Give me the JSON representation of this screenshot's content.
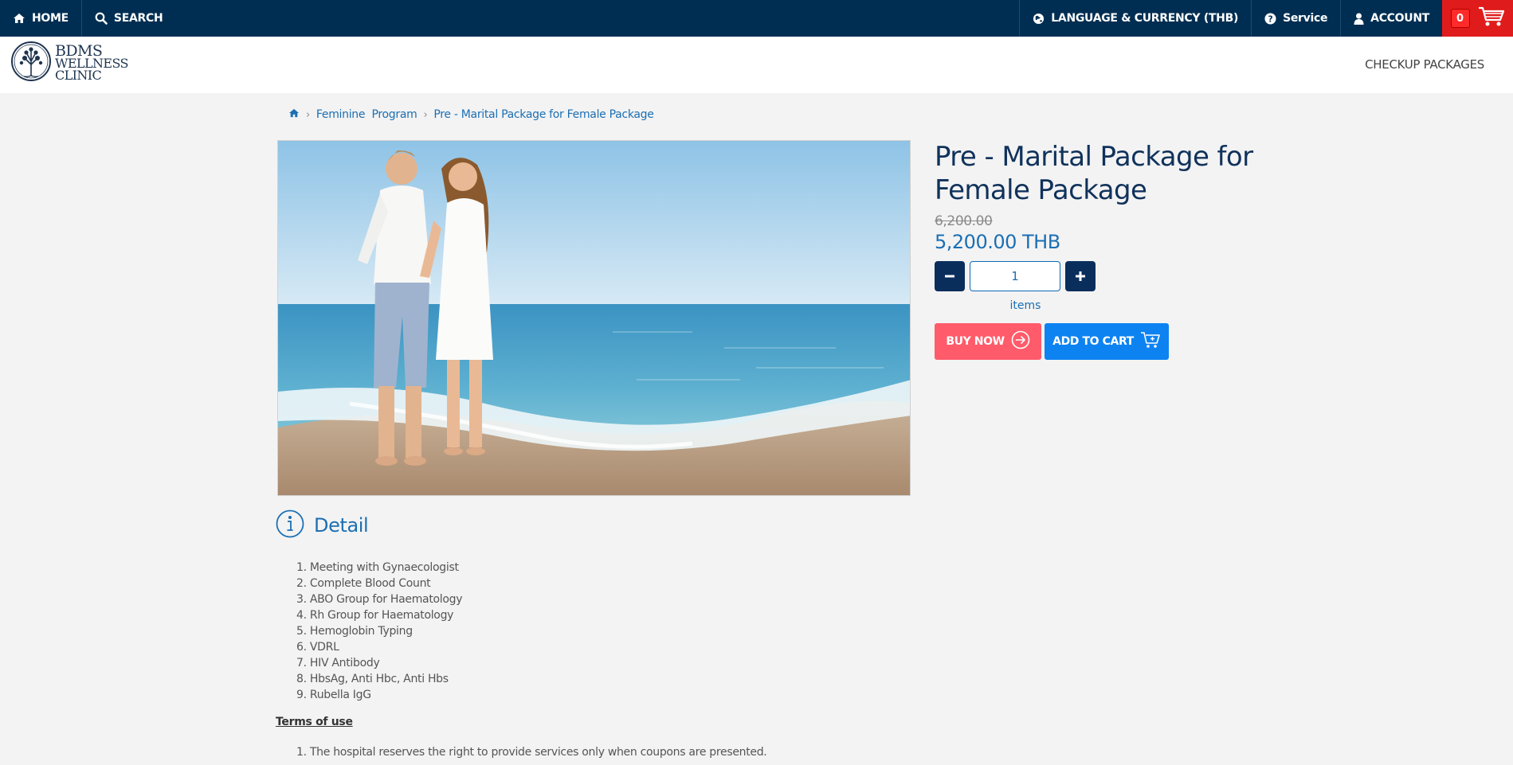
{
  "topbar": {
    "home_label": "HOME",
    "search_label": "SEARCH",
    "language_label": "LANGUAGE & CURRENCY (THB)",
    "service_label": "Service",
    "account_label": "ACCOUNT",
    "cart_count": "0",
    "colors": {
      "bar": "#002e52",
      "cart": "#e01b1b"
    }
  },
  "header": {
    "logo_lines": [
      "BDMS",
      "WELLNESS",
      "CLINIC"
    ],
    "nav_checkup": "CHECKUP PACKAGES"
  },
  "breadcrumb": {
    "category": "Feminine  Program",
    "current": "Pre - Marital Package for Female Package"
  },
  "product": {
    "title_line1": "Pre - Marital Package for",
    "title_line2": "Female Package",
    "old_price": "6,200.00",
    "price": "5,200.00 THB",
    "quantity": "1",
    "items_label": "items",
    "buy_now_label": "BUY NOW",
    "add_to_cart_label": "ADD TO CART",
    "colors": {
      "buy": "#ff5b6a",
      "cart": "#0d83f2",
      "title": "#10325b"
    }
  },
  "detail": {
    "title": "Detail",
    "items": [
      "1. Meeting with Gynaecologist",
      "2. Complete Blood Count",
      "3. ABO Group for Haematology",
      "4. Rh Group for Haematology",
      "5. Hemoglobin Typing",
      "6. VDRL",
      "7. HIV Antibody",
      "8. HbsAg, Anti Hbc, Anti Hbs",
      "9. Rubella IgG"
    ],
    "terms_title": "Terms of use",
    "terms": [
      "1. The hospital reserves the right to provide services only when coupons are presented."
    ]
  }
}
